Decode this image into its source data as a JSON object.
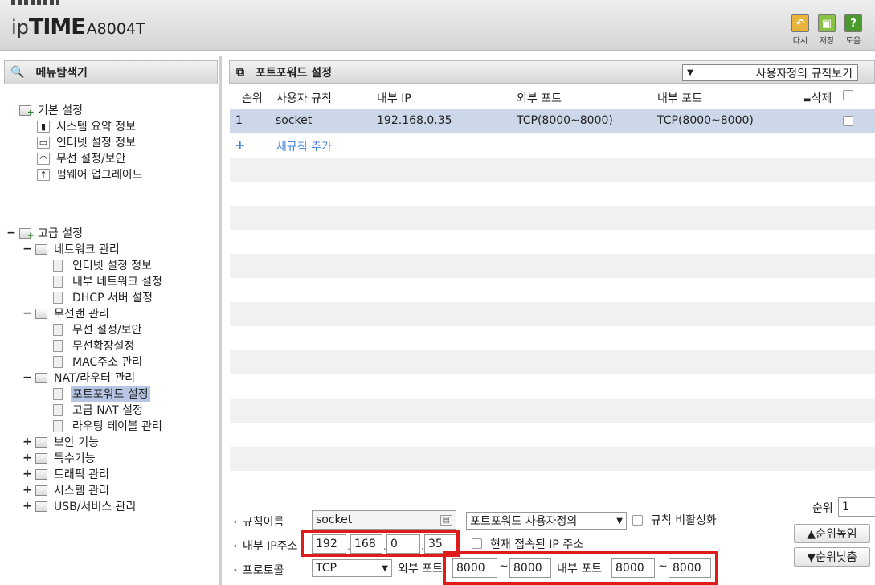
{
  "header": {
    "logo_ip": "ip",
    "logo_time": "TIME",
    "model": "A8004T",
    "buttons": {
      "undo": "다시",
      "save": "저장",
      "help": "도움"
    }
  },
  "left": {
    "title": "메뉴탐색기",
    "basic": {
      "label": "기본 설정",
      "items": [
        "시스템 요약 정보",
        "인터넷 설정 정보",
        "무선 설정/보안",
        "펌웨어 업그레이드"
      ]
    },
    "advanced": {
      "label": "고급 설정",
      "network": {
        "label": "네트워크 관리",
        "items": [
          "인터넷 설정 정보",
          "내부 네트워크 설정",
          "DHCP 서버 설정"
        ]
      },
      "wireless": {
        "label": "무선랜 관리",
        "items": [
          "무선 설정/보안",
          "무선확장설정",
          "MAC주소 관리"
        ]
      },
      "nat": {
        "label": "NAT/라우터 관리",
        "items": [
          "포트포워드 설정",
          "고급 NAT 설정",
          "라우팅 테이블 관리"
        ]
      },
      "collapsed": [
        "보안 기능",
        "특수기능",
        "트래픽 관리",
        "시스템 관리",
        "USB/서비스 관리"
      ]
    }
  },
  "main": {
    "title": "포트포워드 설정",
    "view_select": "사용자정의 규칙보기",
    "table": {
      "headers": {
        "order": "순위",
        "rule": "사용자 규칙",
        "ip": "내부 IP",
        "ext_port": "외부 포트",
        "int_port": "내부 포트",
        "delete": "삭제"
      },
      "rows": [
        {
          "order": "1",
          "rule": "socket",
          "ip": "192.168.0.35",
          "ext_port": "TCP(8000~8000)",
          "int_port": "TCP(8000~8000)"
        }
      ],
      "add_label": "새규칙 추가",
      "add_plus": "+"
    },
    "form": {
      "rule_name_label": "규칙이름",
      "rule_name_value": "socket",
      "rule_type": "포트포워드 사용자정의",
      "disable_label": "규칙 비활성화",
      "ip_label": "내부 IP주소",
      "ip": [
        "192",
        "168",
        "0",
        "35"
      ],
      "current_ip_label": "현재 접속된 IP 주소",
      "protocol_label": "프로토콜",
      "protocol": "TCP",
      "ext_port_label": "외부 포트",
      "ext_from": "8000",
      "ext_to": "8000",
      "int_port_label": "내부 포트",
      "int_from": "8000",
      "int_to": "8000",
      "tilde": "~",
      "order_label": "순위",
      "order_value": "1",
      "raise_label": "▲순위높임",
      "lower_label": "▼순위낮춤"
    }
  },
  "colors": {
    "highlight_box": "#e01b1b",
    "selected_row": "#ccd8ea",
    "link": "#4a86d8"
  }
}
